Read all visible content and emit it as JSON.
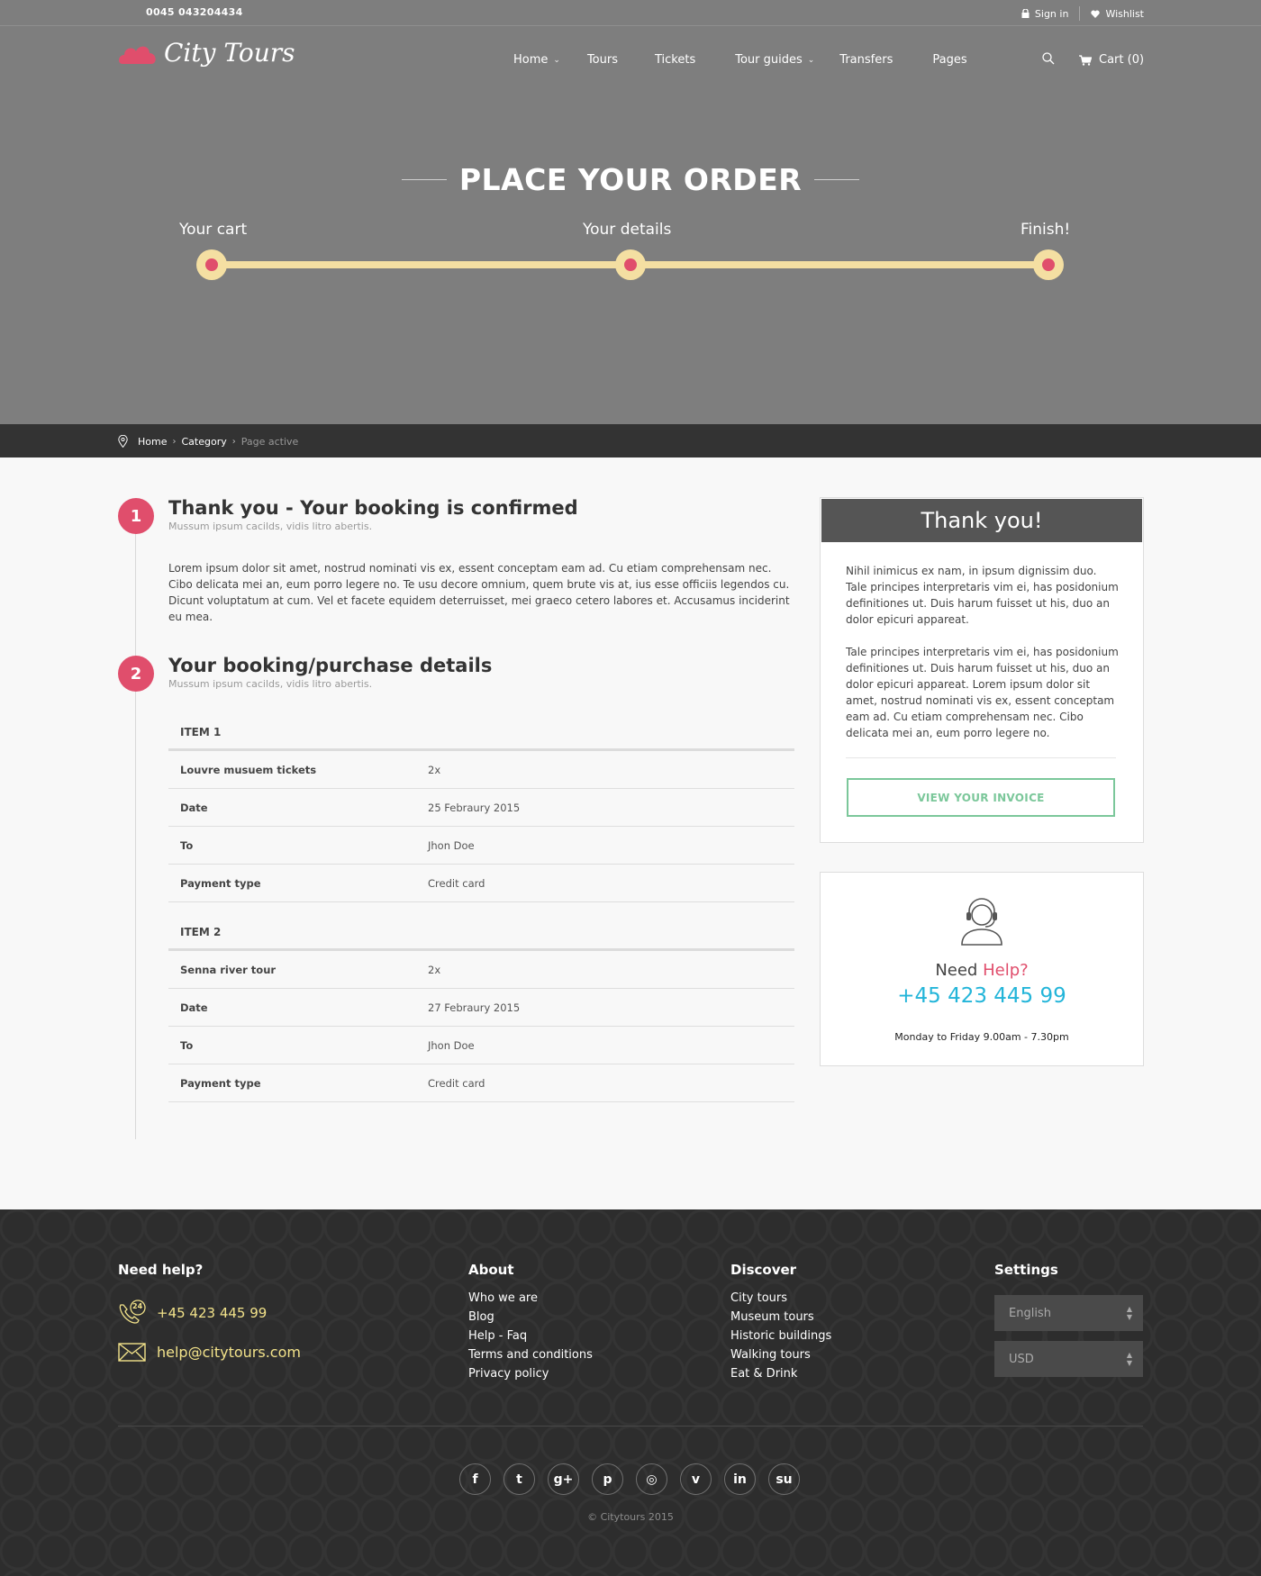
{
  "topbar": {
    "phone": "0045 043204434",
    "sign_in": "Sign in",
    "wishlist": "Wishlist"
  },
  "header": {
    "logo_text": "City Tours",
    "nav": [
      {
        "label": "Home",
        "has_dropdown": true
      },
      {
        "label": "Tours",
        "has_dropdown": false
      },
      {
        "label": "Tickets",
        "has_dropdown": false
      },
      {
        "label": "Tour guides",
        "has_dropdown": true
      },
      {
        "label": "Transfers",
        "has_dropdown": false
      },
      {
        "label": "Pages",
        "has_dropdown": false
      }
    ],
    "cart": "Cart (0)"
  },
  "hero": {
    "title": "PLACE YOUR ORDER",
    "steps": [
      "Your cart",
      "Your details",
      "Finish!"
    ]
  },
  "breadcrumb": {
    "items": [
      "Home",
      "Category"
    ],
    "active": "Page active"
  },
  "section1": {
    "number": "1",
    "title": "Thank you - Your booking is confirmed",
    "subtitle": "Mussum ipsum cacilds, vidis litro abertis.",
    "body": "Lorem ipsum dolor sit amet, nostrud nominati vis ex, essent conceptam eam ad. Cu etiam comprehensam nec. Cibo delicata mei an, eum porro legere no. Te usu decore omnium, quem brute vis at, ius esse officiis legendos cu. Dicunt voluptatum at cum. Vel et facete equidem deterruisset, mei graeco cetero labores et. Accusamus inciderint eu mea."
  },
  "section2": {
    "number": "2",
    "title": "Your booking/purchase details",
    "subtitle": "Mussum ipsum cacilds, vidis litro abertis.",
    "items": [
      {
        "header": "ITEM 1",
        "rows": [
          {
            "label": "Louvre musuem tickets",
            "value": "2x"
          },
          {
            "label": "Date",
            "value": "25 Febraury 2015"
          },
          {
            "label": "To",
            "value": "Jhon Doe"
          },
          {
            "label": "Payment type",
            "value": "Credit card"
          }
        ]
      },
      {
        "header": "ITEM 2",
        "rows": [
          {
            "label": "Senna river tour",
            "value": "2x"
          },
          {
            "label": "Date",
            "value": "27 Febraury 2015"
          },
          {
            "label": "To",
            "value": "Jhon Doe"
          },
          {
            "label": "Payment type",
            "value": "Credit card"
          }
        ]
      }
    ]
  },
  "sidebar": {
    "thank_title": "Thank you!",
    "para1": "Nihil inimicus ex nam, in ipsum dignissim duo. Tale principes interpretaris vim ei, has posidonium definitiones ut. Duis harum fuisset ut his, duo an dolor epicuri appareat.",
    "para2": "Tale principes interpretaris vim ei, has posidonium definitiones ut. Duis harum fuisset ut his, duo an dolor epicuri appareat. Lorem ipsum dolor sit amet, nostrud nominati vis ex, essent conceptam eam ad. Cu etiam comprehensam nec. Cibo delicata mei an, eum porro legere no.",
    "invoice_button": "VIEW YOUR INVOICE",
    "help_need": "Need",
    "help_word": "Help?",
    "help_phone": "+45 423 445 99",
    "help_hours": "Monday to Friday 9.00am - 7.30pm"
  },
  "footer": {
    "need_help_title": "Need help?",
    "phone": "+45 423 445 99",
    "email": "help@citytours.com",
    "phone_badge": "24",
    "about_title": "About",
    "about_links": [
      "Who we are",
      "Blog",
      "Help - Faq",
      "Terms and conditions",
      "Privacy policy"
    ],
    "discover_title": "Discover",
    "discover_links": [
      "City tours",
      "Museum tours",
      "Historic buildings",
      "Walking tours",
      "Eat & Drink"
    ],
    "settings_title": "Settings",
    "language": "English",
    "currency": "USD",
    "socials": [
      {
        "name": "facebook",
        "glyph": "f"
      },
      {
        "name": "twitter",
        "glyph": "t"
      },
      {
        "name": "google-plus",
        "glyph": "g+"
      },
      {
        "name": "pinterest",
        "glyph": "p"
      },
      {
        "name": "instagram",
        "glyph": "◎"
      },
      {
        "name": "vimeo",
        "glyph": "v"
      },
      {
        "name": "linkedin",
        "glyph": "in"
      },
      {
        "name": "stumbleupon",
        "glyph": "su"
      }
    ],
    "copyright": "© Citytours 2015"
  },
  "colors": {
    "accent_pink": "#e04e6c",
    "progress_yellow": "#f4dfa2",
    "phone_blue": "#23b5d9",
    "invoice_green": "#7bc79a",
    "footer_yellow": "#f2e28a"
  }
}
